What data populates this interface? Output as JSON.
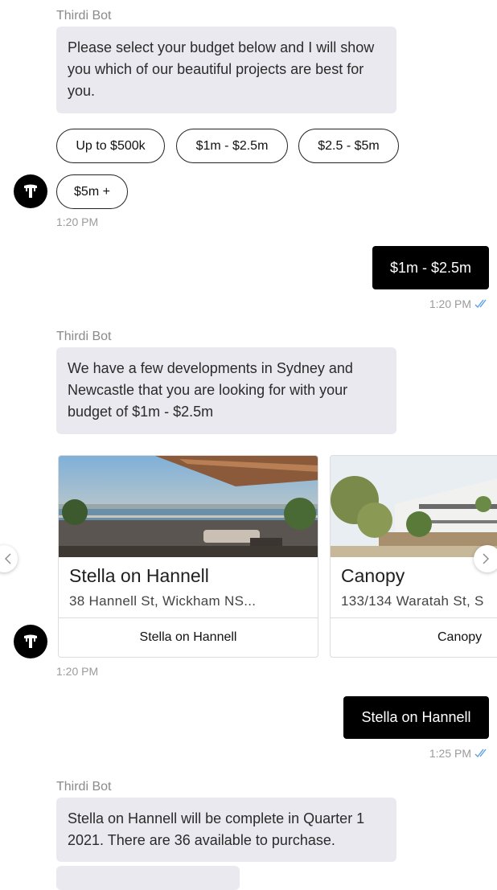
{
  "bot_name": "Thirdi Bot",
  "messages": {
    "m1": {
      "sender": "Thirdi Bot",
      "text": "Please select your budget below and I will show you which of our beautiful projects are best for you.",
      "quick_replies": [
        "Up to $500k",
        "$1m - $2.5m",
        "$2.5 - $5m",
        "$5m +"
      ],
      "time": "1:20 PM"
    },
    "u1": {
      "text": "$1m - $2.5m",
      "time": "1:20 PM"
    },
    "m2": {
      "sender": "Thirdi Bot",
      "text": "We have a few developments in Sydney and Newcastle that you are looking for with your budget of $1m - $2.5m",
      "time": "1:20 PM",
      "cards": [
        {
          "title": "Stella on Hannell",
          "subtitle": "38 Hannell St, Wickham NS...",
          "button": "Stella on Hannell"
        },
        {
          "title": "Canopy",
          "subtitle": "133/134 Waratah St, S",
          "button": "Canopy"
        }
      ]
    },
    "u2": {
      "text": "Stella on Hannell",
      "time": "1:25 PM"
    },
    "m3": {
      "sender": "Thirdi Bot",
      "text": "Stella on Hannell will be complete in Quarter 1 2021. There are 36 available to purchase."
    }
  },
  "icons": {
    "avatar": "thirdi-logo-icon",
    "read_receipt": "double-check-icon",
    "prev": "chevron-left-icon",
    "next": "chevron-right-icon"
  },
  "colors": {
    "bot_bubble": "#e9e9ef",
    "user_bubble": "#000000",
    "read_receipt": "#5aa0e6"
  }
}
